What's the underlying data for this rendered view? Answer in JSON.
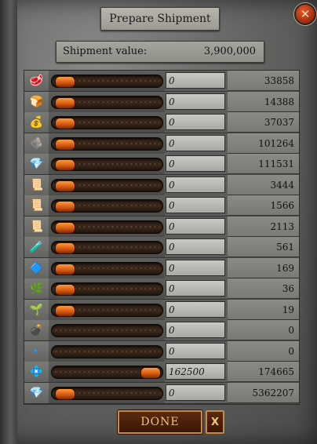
{
  "dialog": {
    "title": "Prepare Shipment",
    "close_icon": "close-icon",
    "shipment_value_label": "Shipment value:",
    "shipment_value": "3,900,000",
    "done_label": "DONE",
    "cancel_label": "X"
  },
  "resources": [
    {
      "icon": "meat-resource-icon",
      "glyph": "🥩",
      "slider_fraction": 0,
      "input": "0",
      "available": "33858"
    },
    {
      "icon": "bread-resource-icon",
      "glyph": "🍞",
      "slider_fraction": 0,
      "input": "0",
      "available": "14388"
    },
    {
      "icon": "gold-resource-icon",
      "glyph": "💰",
      "slider_fraction": 0,
      "input": "0",
      "available": "37037"
    },
    {
      "icon": "stone-resource-icon",
      "glyph": "🪨",
      "slider_fraction": 0,
      "input": "0",
      "available": "101264"
    },
    {
      "icon": "ore-resource-icon",
      "glyph": "💎",
      "slider_fraction": 0,
      "input": "0",
      "available": "111531"
    },
    {
      "icon": "red-scroll-resource-icon",
      "glyph": "📜",
      "slider_fraction": 0,
      "input": "0",
      "available": "3444"
    },
    {
      "icon": "green-scroll-resource-icon",
      "glyph": "📜",
      "slider_fraction": 0,
      "input": "0",
      "available": "1566"
    },
    {
      "icon": "orange-scroll-resource-icon",
      "glyph": "📜",
      "slider_fraction": 0,
      "input": "0",
      "available": "2113"
    },
    {
      "icon": "potion-resource-icon",
      "glyph": "🧪",
      "slider_fraction": 0,
      "input": "0",
      "available": "561"
    },
    {
      "icon": "blue-crystal-resource-icon",
      "glyph": "🔷",
      "slider_fraction": 0,
      "input": "0",
      "available": "169"
    },
    {
      "icon": "herb-resource-icon",
      "glyph": "🌿",
      "slider_fraction": 0,
      "input": "0",
      "available": "36"
    },
    {
      "icon": "plant-resource-icon",
      "glyph": "🌱",
      "slider_fraction": 0,
      "input": "0",
      "available": "19"
    },
    {
      "icon": "bomb-resource-icon",
      "glyph": "💣",
      "slider_fraction": null,
      "input": "0",
      "available": "0"
    },
    {
      "icon": "crystal-shard-resource-icon",
      "glyph": "🔹",
      "slider_fraction": null,
      "input": "0",
      "available": "0"
    },
    {
      "icon": "blue-gem-resource-icon",
      "glyph": "💠",
      "slider_fraction": 1,
      "input": "162500",
      "available": "174665"
    },
    {
      "icon": "sapphire-resource-icon",
      "glyph": "💎",
      "slider_fraction": 0,
      "input": "0",
      "available": "5362207"
    }
  ]
}
